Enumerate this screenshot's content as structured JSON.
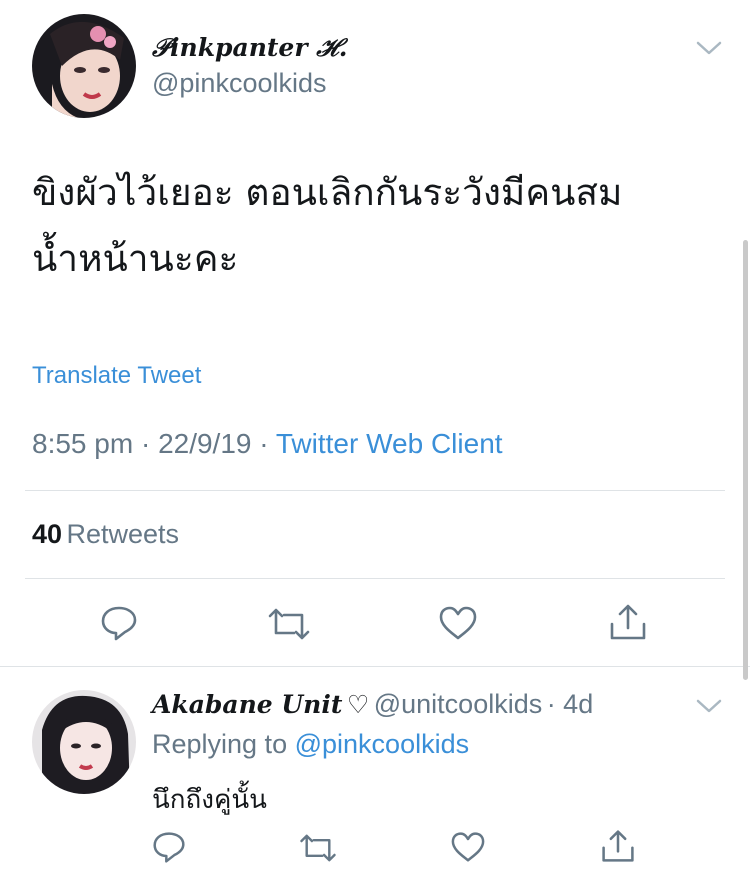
{
  "tweet": {
    "author_name": "𝒫inkpanter ℋ.",
    "author_handle": "@pinkcoolkids",
    "text_line1": "ขิงผัวไว้เยอะ ตอนเลิกกันระวังมีคนสม",
    "text_line2": "น้ำหน้านะคะ",
    "translate_label": "Translate Tweet",
    "time": "8:55 pm",
    "date": "22/9/19",
    "separator": "·",
    "client": "Twitter Web Client",
    "retweet_count": "40",
    "retweet_label": "Retweets"
  },
  "reply": {
    "author_name": "Akabane Unit",
    "heart_glyph": "♡",
    "author_handle": "@unitcoolkids",
    "age": "· 4d",
    "replying_prefix": "Replying to",
    "replying_to": "@pinkcoolkids",
    "text": "นึกถึงคู่นั้น"
  },
  "icons": {
    "reply": "reply-icon",
    "retweet": "retweet-icon",
    "like": "heart-icon",
    "share": "share-icon",
    "more": "chevron-down-icon"
  },
  "colors": {
    "link": "#3a8fd8",
    "secondary_text": "#657786",
    "primary_text": "#14171a",
    "icon": "#657786",
    "divider": "#dfe3e6"
  }
}
